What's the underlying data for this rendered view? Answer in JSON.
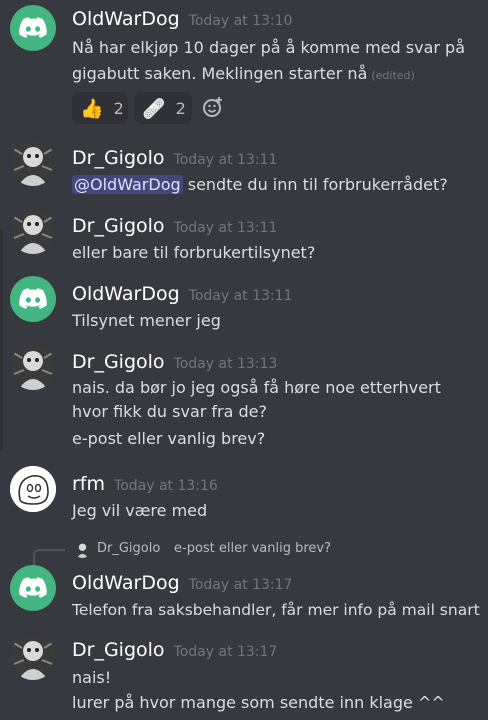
{
  "messages": [
    {
      "user": "OldWarDog",
      "time": "Today at 13:10",
      "avatar": "discord-logo-icon",
      "lines": [
        "Nå har elkjøp 10 dager på å komme med svar på",
        "gigabutt saken. Meklingen starter nå"
      ],
      "edited": "(edited)",
      "reactions": [
        {
          "emoji": "👍",
          "icon": "thumbs-up-icon",
          "count": "2"
        },
        {
          "emoji": "🩹",
          "icon": "bandage-icon",
          "count": "2"
        }
      ]
    },
    {
      "user": "Dr_Gigolo",
      "time": "Today at 13:11",
      "avatar": "gigolo-avatar",
      "mention": "@OldWarDog",
      "lines": [
        " sendte du inn til forbrukerrådet?"
      ]
    },
    {
      "user": "Dr_Gigolo",
      "time": "Today at 13:11",
      "avatar": "gigolo-avatar",
      "lines": [
        "eller bare til forbrukertilsynet?"
      ]
    },
    {
      "user": "OldWarDog",
      "time": "Today at 13:11",
      "avatar": "discord-logo-icon",
      "lines": [
        "Tilsynet mener jeg"
      ]
    },
    {
      "user": "Dr_Gigolo",
      "time": "Today at 13:13",
      "avatar": "gigolo-avatar",
      "lines": [
        "nais. da bør jo jeg også få høre noe etterhvert",
        "hvor fikk du svar fra de?",
        "e-post eller vanlig brev?"
      ]
    },
    {
      "user": "rfm",
      "time": "Today at 13:16",
      "avatar": "rfm-avatar",
      "lines": [
        "Jeg vil være med"
      ]
    },
    {
      "user": "OldWarDog",
      "time": "Today at 13:17",
      "avatar": "discord-logo-icon",
      "reply": {
        "user": "Dr_Gigolo",
        "text": "e-post eller vanlig brev?"
      },
      "lines": [
        "Telefon fra saksbehandler, får mer info på mail snart"
      ]
    },
    {
      "user": "Dr_Gigolo",
      "time": "Today at 13:17",
      "avatar": "gigolo-avatar",
      "lines": [
        "nais!",
        "lurer på hvor mange som sendte inn klage ^^"
      ]
    }
  ],
  "colors": {
    "background": "#36393f",
    "discord_green": "#43b581",
    "mention_bg": "#5865f2"
  }
}
